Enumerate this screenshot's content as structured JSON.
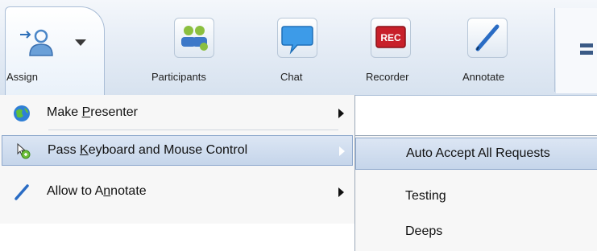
{
  "toolbar": {
    "assign_label": "Assign",
    "tools": [
      {
        "label": "Participants",
        "icon": "participants-icon"
      },
      {
        "label": "Chat",
        "icon": "chat-bubble-icon"
      },
      {
        "label": "Recorder",
        "icon": "rec-icon",
        "badge": "REC"
      },
      {
        "label": "Annotate",
        "icon": "pen-icon"
      }
    ]
  },
  "menu": {
    "items": [
      {
        "label_pre": "Make ",
        "label_key": "P",
        "label_post": "resenter",
        "icon": "globe-icon",
        "has_submenu": true
      },
      {
        "label_pre": "Pass ",
        "label_key": "K",
        "label_post": "eyboard and Mouse Control",
        "icon": "keyboard-mouse-icon",
        "has_submenu": true,
        "highlighted": true
      },
      {
        "label_pre": "Allow to A",
        "label_key": "n",
        "label_post": "notate",
        "icon": "pen-icon",
        "has_submenu": true
      }
    ]
  },
  "submenu": {
    "items": [
      {
        "label": "Auto Accept All Requests",
        "highlighted": true
      },
      {
        "label": "Testing"
      },
      {
        "label": "Deeps"
      }
    ]
  },
  "colors": {
    "highlight": "#c5d5ea",
    "accent": "#3a5a86"
  }
}
